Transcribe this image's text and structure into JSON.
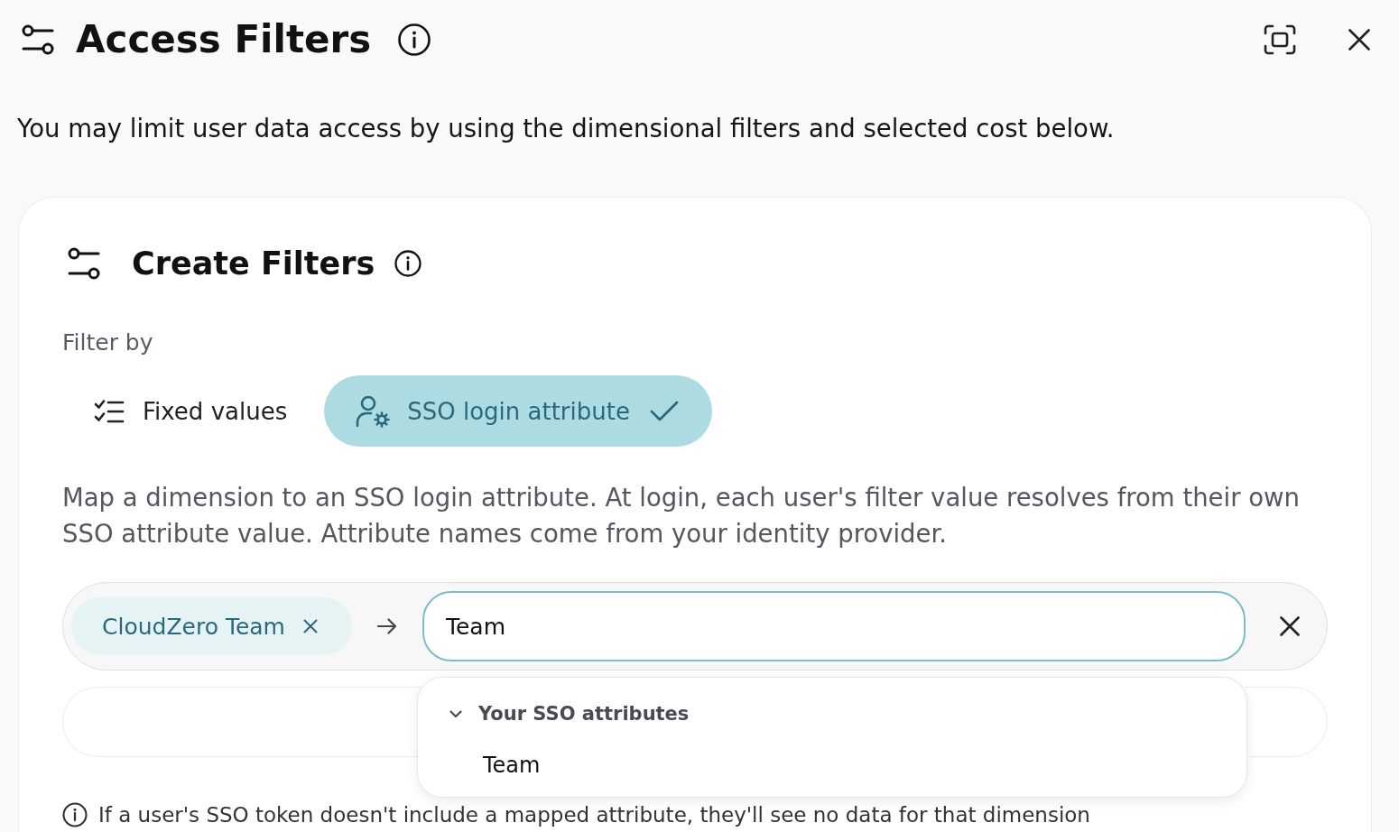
{
  "header": {
    "title": "Access Filters"
  },
  "description": "You may limit user data access by using the dimensional filters and selected cost below.",
  "create_filters": {
    "title": "Create Filters",
    "filter_by": {
      "label": "Filter by",
      "options": [
        {
          "label": "Fixed values",
          "kind": "fixed",
          "selected": false
        },
        {
          "label": "SSO login attribute",
          "kind": "sso",
          "selected": true
        }
      ]
    },
    "help_text": "Map a dimension to an SSO login attribute. At login, each user's filter value resolves from their own SSO attribute value. Attribute names come from your identity provider.",
    "mapping_rows": [
      {
        "kind": "mapping",
        "dimension": "CloudZero Team",
        "attribute": "Team",
        "focused": true
      },
      {
        "kind": "empty"
      }
    ],
    "note": "If a user's SSO token doesn't include a mapped attribute, they'll see no data for that dimension"
  },
  "dropdown": {
    "groups": [
      {
        "label": "Your SSO attributes",
        "expanded": true,
        "options": [
          {
            "label": "Team",
            "selected": false
          }
        ]
      }
    ]
  }
}
